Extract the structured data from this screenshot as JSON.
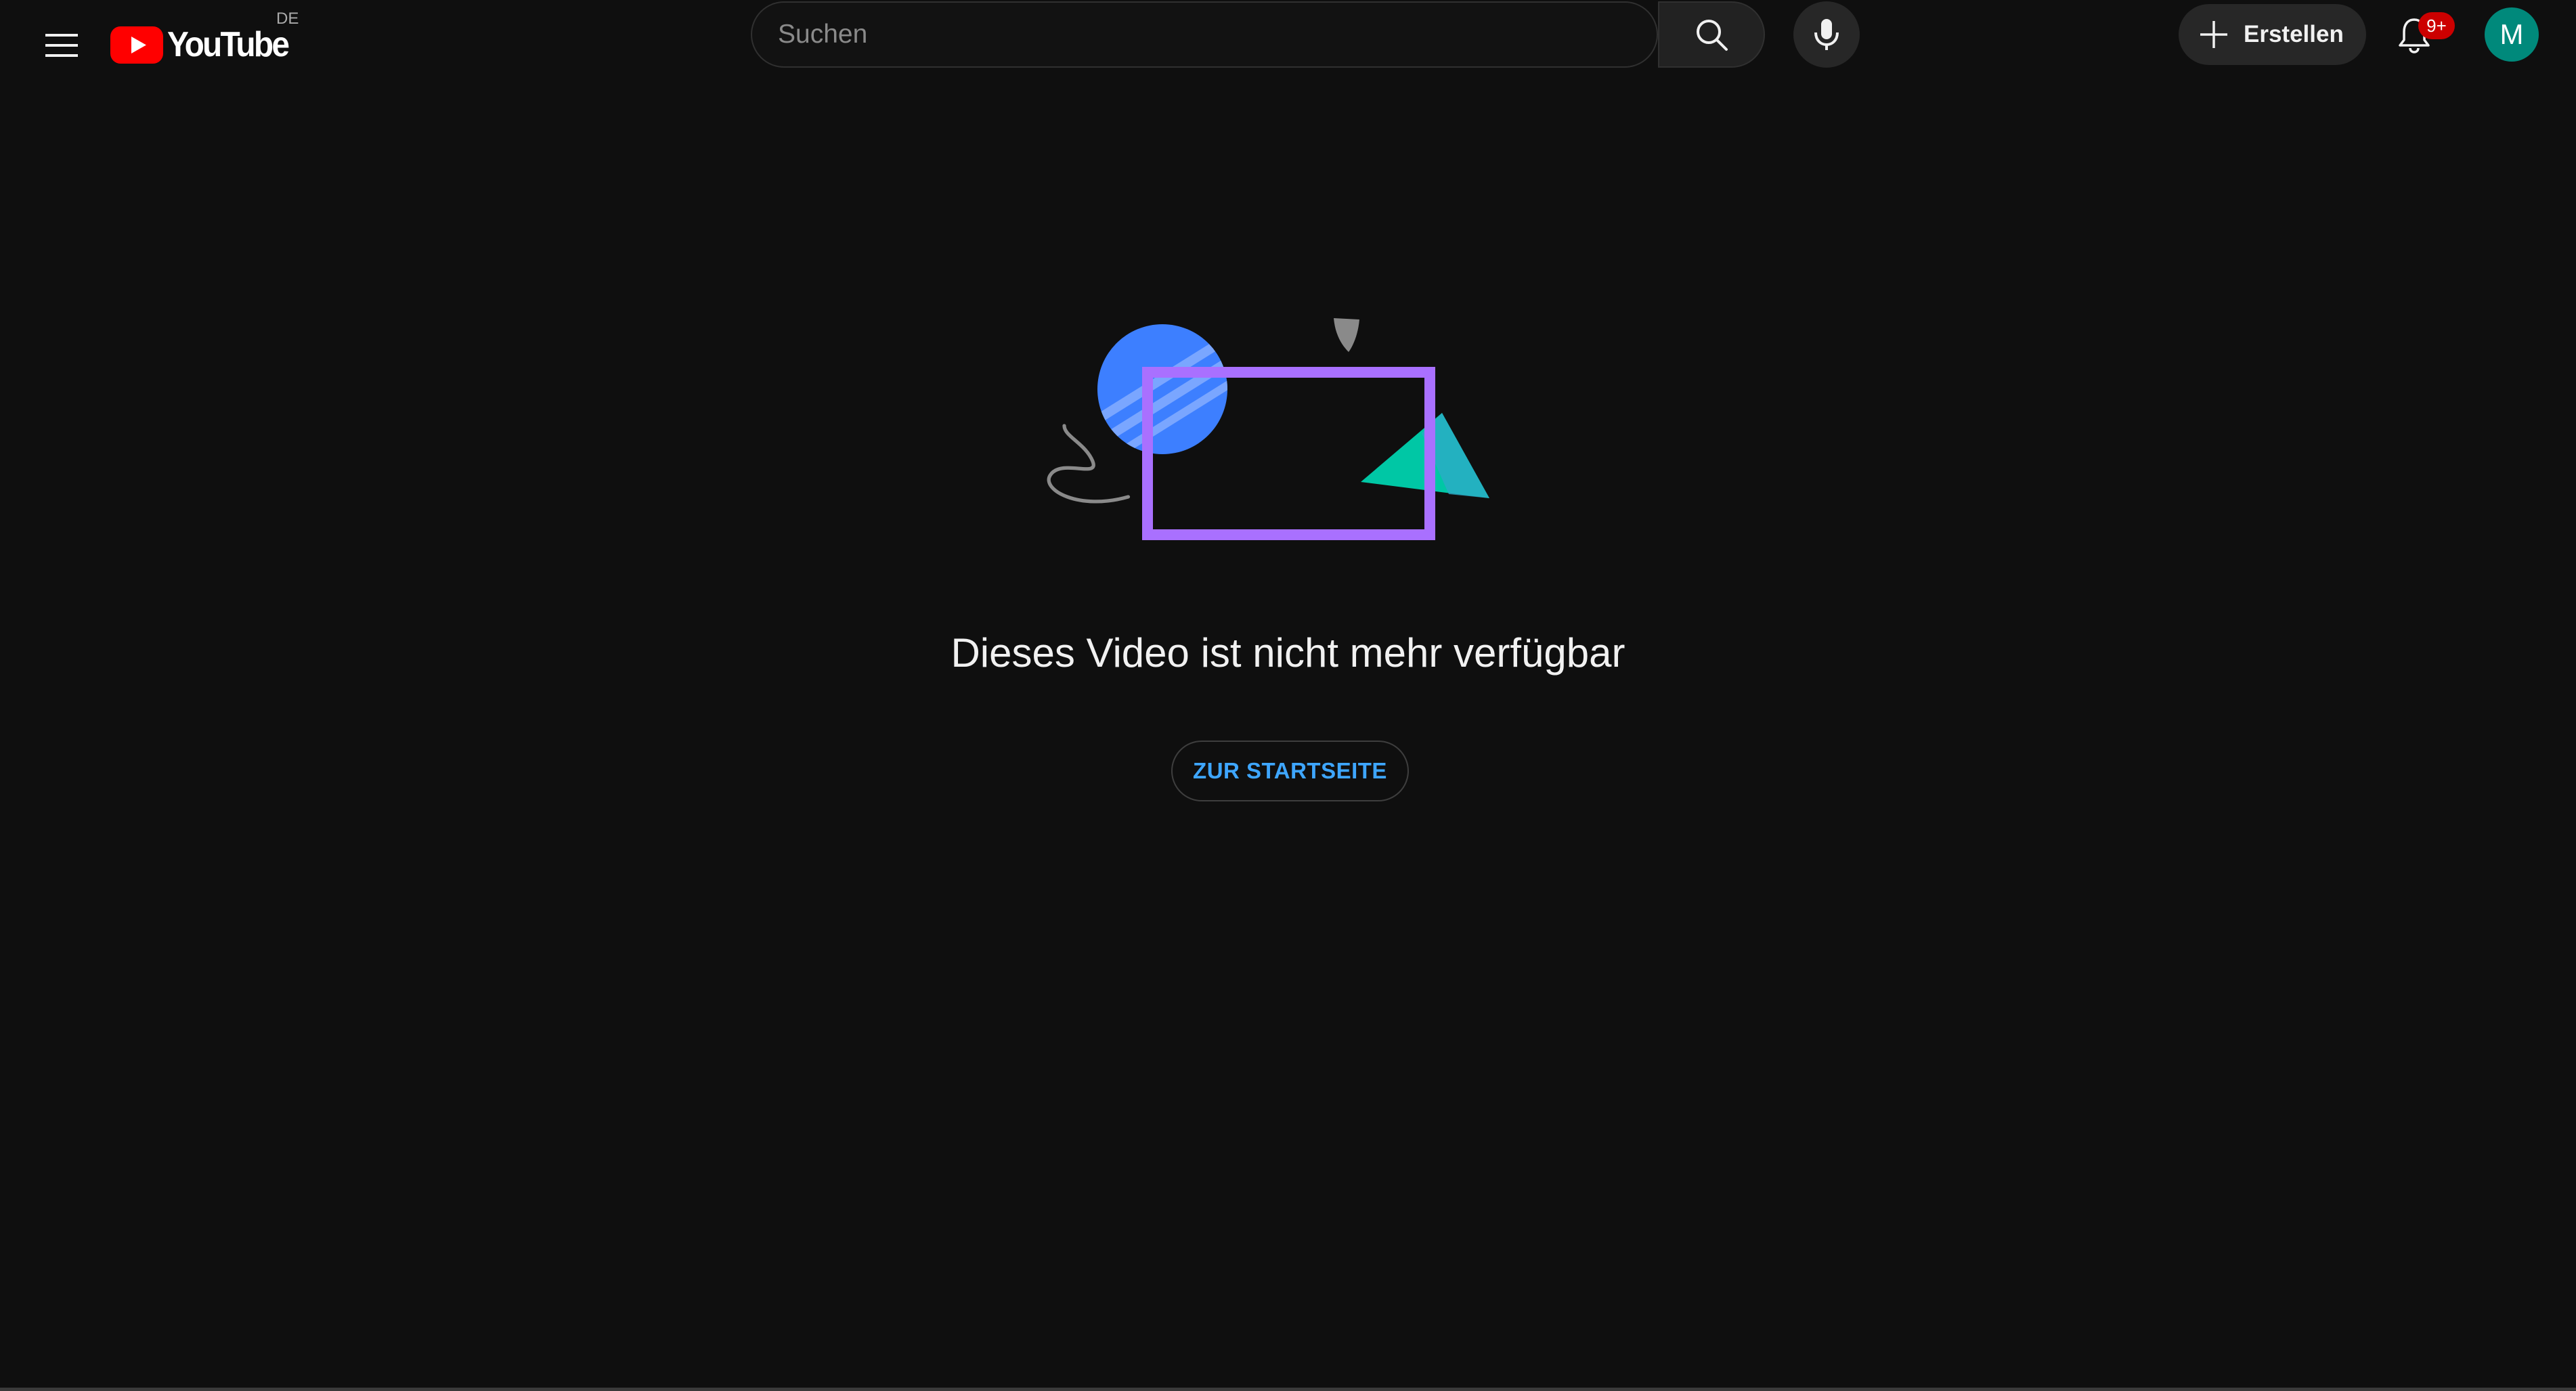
{
  "masthead": {
    "menu_icon": "hamburger-menu-icon",
    "logo_text": "YouTube",
    "logo_region": "DE",
    "search": {
      "placeholder": "Suchen",
      "value": "",
      "icon": "search-icon"
    },
    "mic_icon": "microphone-icon",
    "create": {
      "icon": "plus-icon",
      "label": "Erstellen"
    },
    "notifications": {
      "icon": "bell-icon",
      "badge": "9+"
    },
    "avatar_initial": "M"
  },
  "error": {
    "illustration": "unavailable-video-illustration",
    "title": "Dieses Video ist nicht mehr verfügbar",
    "button_label": "ZUR STARTSEITE"
  },
  "colors": {
    "background": "#0f0f0f",
    "logo_red": "#ff0000",
    "badge_red": "#cc0000",
    "avatar": "#00897b",
    "link_blue": "#3ea6ff",
    "illustration_purple": "#a970ff",
    "illustration_blue": "#3d7fff",
    "illustration_teal": "#00c7a5"
  }
}
